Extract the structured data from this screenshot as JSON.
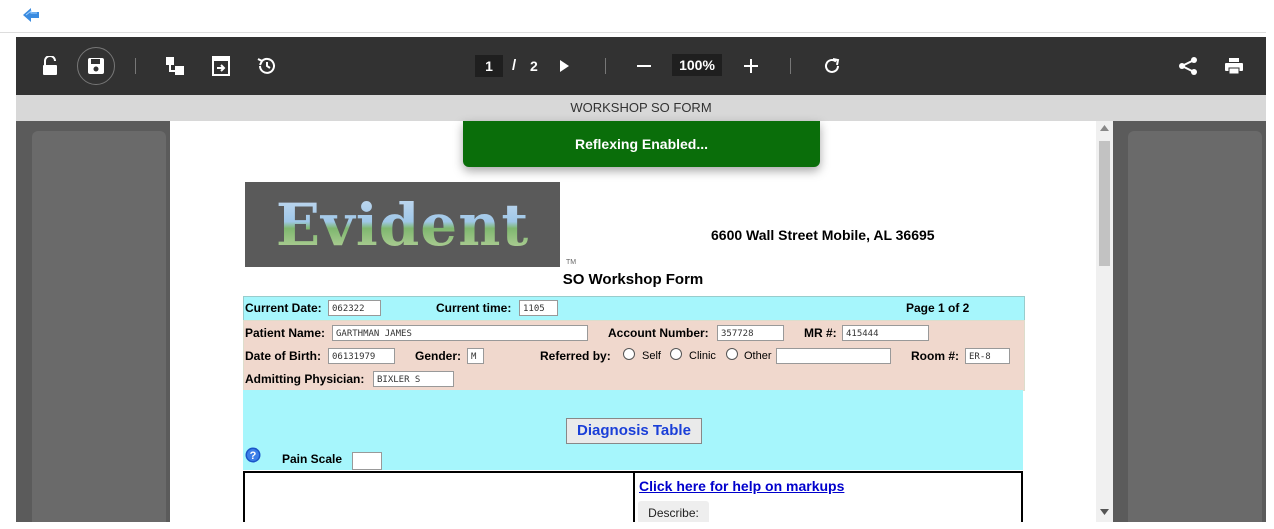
{
  "toolbar": {
    "current_page": "1",
    "page_separator": "/",
    "total_pages": "2",
    "zoom": "100%"
  },
  "document_title": "WORKSHOP SO FORM",
  "toast": "Reflexing Enabled...",
  "form": {
    "logo_text": "Evident",
    "trademark": "TM",
    "address": "6600 Wall Street Mobile, AL 36695",
    "title": "SO Workshop Form",
    "current_date_label": "Current Date:",
    "current_date": "062322",
    "current_time_label": "Current time:",
    "current_time": "1105",
    "page_label": "Page 1 of 2",
    "patient_name_label": "Patient Name:",
    "patient_name": "GARTHMAN JAMES",
    "account_number_label": "Account Number:",
    "account_number": "357728",
    "mr_label": "MR #:",
    "mr_number": "415444",
    "dob_label": "Date of Birth:",
    "dob": "06131979",
    "gender_label": "Gender:",
    "gender": "M",
    "referred_by_label": "Referred by:",
    "referral_options": [
      "Self",
      "Clinic",
      "Other"
    ],
    "room_label": "Room #:",
    "room": "ER-8",
    "admitting_physician_label": "Admitting Physician:",
    "admitting_physician": "BIXLER S",
    "diagnosis_button": "Diagnosis Table",
    "pain_scale_label": "Pain Scale",
    "help_link": "Click here for help on markups",
    "describe_label": "Describe:"
  },
  "colors": {
    "toolbar_bg": "#323232",
    "toast_bg": "#0a6e0a",
    "row_cyan": "#a6f6fc",
    "row_peach": "#f0d8cd",
    "link": "#0000cc"
  }
}
